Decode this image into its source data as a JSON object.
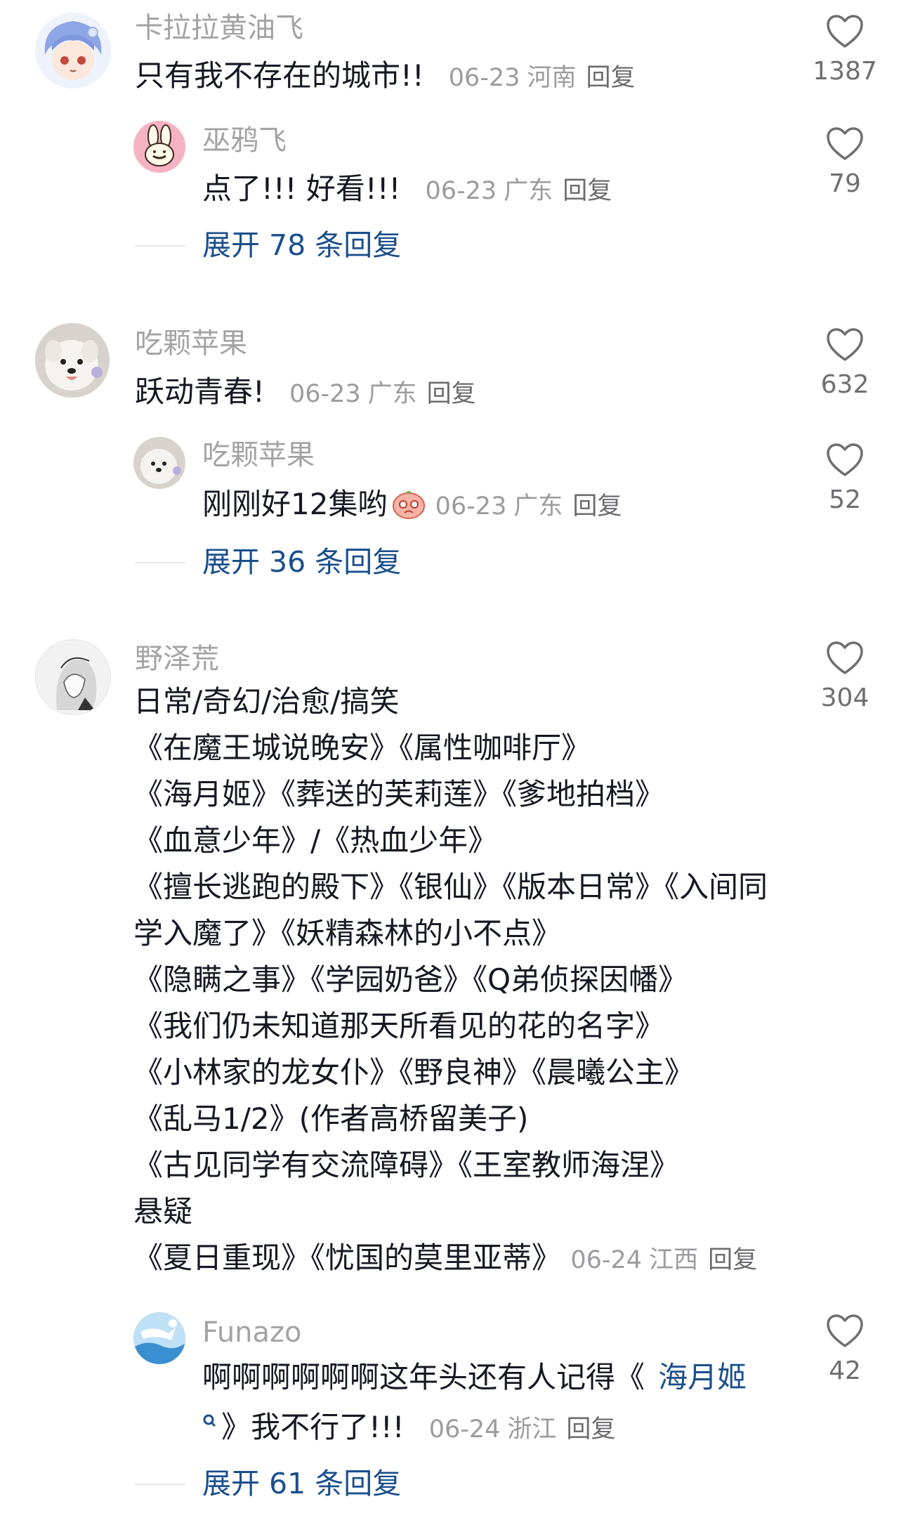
{
  "comments": [
    {
      "user": "卡拉拉黄油飞",
      "text": "只有我不存在的城市!!",
      "date": "06-23",
      "location": "河南",
      "reply_label": "回复",
      "likes": "1387",
      "sub": {
        "user": "巫鸦飞",
        "text": "点了!!!  好看!!!",
        "date": "06-23",
        "location": "广东",
        "reply_label": "回复",
        "likes": "79"
      },
      "expand_label": "展开 78 条回复"
    },
    {
      "user": "吃颗苹果",
      "text": "跃动青春!",
      "date": "06-23",
      "location": "广东",
      "reply_label": "回复",
      "likes": "632",
      "sub": {
        "user": "吃颗苹果",
        "text": "刚刚好12集哟",
        "date": "06-23",
        "location": "广东",
        "reply_label": "回复",
        "likes": "52"
      },
      "expand_label": "展开 36 条回复"
    },
    {
      "user": "野泽荒",
      "likes": "304",
      "lines": [
        "日常/奇幻/治愈/搞笑",
        "《在魔王城说晚安》《属性咖啡厅》",
        "《海月姬》《葬送的芙莉莲》《爹地拍档》",
        "《血意少年》/《热血少年》",
        "《擅长逃跑的殿下》《银仙》《版本日常》《入间同",
        "学入魔了》《妖精森林的小不点》",
        "《隐瞒之事》《学园奶爸》《Q弟侦探因幡》",
        "《我们仍未知道那天所看见的花的名字》",
        "《小林家的龙女仆》《野良神》《晨曦公主》",
        "《乱马1/2》(作者高桥留美子)",
        "《古见同学有交流障碍》《王室教师海涅》",
        "悬疑",
        "《夏日重现》《忧国的莫里亚蒂》"
      ],
      "date": "06-24",
      "location": "江西",
      "reply_label": "回复",
      "sub": {
        "user": "Funazo",
        "text_prefix": "啊啊啊啊啊啊这年头还有人记得《",
        "link_text": "海月姬",
        "text_suffix": "》我不行了!!!",
        "date": "06-24",
        "location": "浙江",
        "reply_label": "回复",
        "likes": "42"
      },
      "expand_label": "展开 61 条回复"
    }
  ],
  "colors": {
    "text": "#161823",
    "muted": "#a3a3a6",
    "link": "#1b4f8d"
  }
}
